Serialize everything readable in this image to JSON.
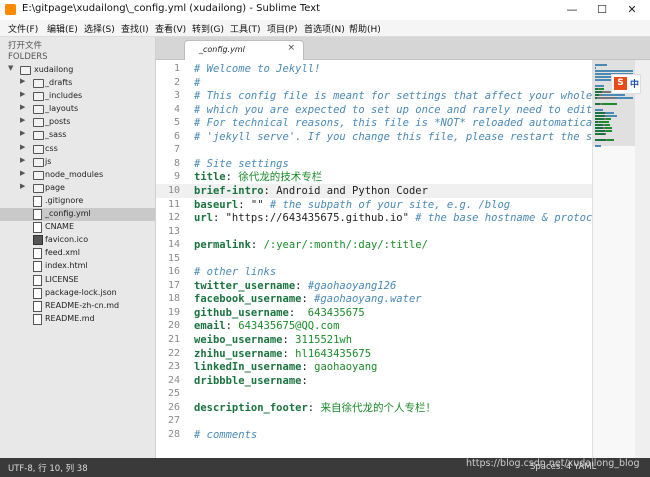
{
  "window": {
    "title": "E:\\gitpage\\xudailong\\_config.yml (xudailong) - Sublime Text",
    "minimize": "—",
    "maximize": "☐",
    "close": "✕"
  },
  "menu": [
    "文件(F)",
    "编辑(E)",
    "选择(S)",
    "查找(I)",
    "查看(V)",
    "转到(G)",
    "工具(T)",
    "项目(P)",
    "首选项(N)",
    "帮助(H)"
  ],
  "sidebar": {
    "open_files": "打开文件",
    "folders_label": "FOLDERS",
    "root": "xudailong",
    "items": [
      {
        "type": "folder",
        "label": "_drafts"
      },
      {
        "type": "folder",
        "label": "_includes"
      },
      {
        "type": "folder",
        "label": "_layouts"
      },
      {
        "type": "folder",
        "label": "_posts"
      },
      {
        "type": "folder",
        "label": "_sass"
      },
      {
        "type": "folder",
        "label": "css"
      },
      {
        "type": "folder",
        "label": "js"
      },
      {
        "type": "folder",
        "label": "node_modules"
      },
      {
        "type": "folder",
        "label": "page"
      },
      {
        "type": "file",
        "label": ".gitignore"
      },
      {
        "type": "file",
        "label": "_config.yml",
        "selected": true
      },
      {
        "type": "file",
        "label": "CNAME"
      },
      {
        "type": "image",
        "label": "favicon.ico"
      },
      {
        "type": "file",
        "label": "feed.xml"
      },
      {
        "type": "file",
        "label": "index.html"
      },
      {
        "type": "file",
        "label": "LICENSE"
      },
      {
        "type": "file",
        "label": "package-lock.json"
      },
      {
        "type": "file",
        "label": "README-zh-cn.md"
      },
      {
        "type": "file",
        "label": "README.md"
      }
    ]
  },
  "tab": {
    "label": "_config.yml",
    "close": "×"
  },
  "editor": {
    "current_line": 10,
    "lines": [
      {
        "n": "1",
        "parts": [
          {
            "t": "# Welcome to Jekyll!",
            "c": "comment"
          }
        ]
      },
      {
        "n": "2",
        "parts": [
          {
            "t": "#",
            "c": "comment"
          }
        ]
      },
      {
        "n": "3",
        "parts": [
          {
            "t": "# This config file is meant for settings that affect your whole",
            "c": "comment"
          }
        ]
      },
      {
        "n": "4",
        "parts": [
          {
            "t": "# which you are expected to set up once and rarely need to edit",
            "c": "comment"
          }
        ]
      },
      {
        "n": "5",
        "parts": [
          {
            "t": "# For technical reasons, this file is *NOT* reloaded automatica",
            "c": "comment"
          }
        ]
      },
      {
        "n": "6",
        "parts": [
          {
            "t": "# 'jekyll serve'. If you change this file, please restart the se",
            "c": "comment"
          }
        ]
      },
      {
        "n": "7",
        "parts": []
      },
      {
        "n": "8",
        "parts": [
          {
            "t": "# Site settings",
            "c": "comment"
          }
        ]
      },
      {
        "n": "9",
        "parts": [
          {
            "t": "title",
            "c": "key"
          },
          {
            "t": ": ",
            "c": "val"
          },
          {
            "t": "徐代龙的技术专栏",
            "c": "str"
          }
        ]
      },
      {
        "n": "10",
        "parts": [
          {
            "t": "brief-intro",
            "c": "key"
          },
          {
            "t": ": Android and Python Coder",
            "c": "val"
          }
        ]
      },
      {
        "n": "11",
        "parts": [
          {
            "t": "baseurl",
            "c": "key"
          },
          {
            "t": ": \"\" ",
            "c": "val"
          },
          {
            "t": "# the subpath of your site, e.g. /blog",
            "c": "comment"
          }
        ]
      },
      {
        "n": "12",
        "parts": [
          {
            "t": "url",
            "c": "key"
          },
          {
            "t": ": \"https://643435675.github.io\" ",
            "c": "val"
          },
          {
            "t": "# the base hostname & protoco",
            "c": "comment"
          }
        ]
      },
      {
        "n": "13",
        "parts": []
      },
      {
        "n": "14",
        "parts": [
          {
            "t": "permalink",
            "c": "key"
          },
          {
            "t": ": ",
            "c": "val"
          },
          {
            "t": "/:year/:month/:day/:title/",
            "c": "str"
          }
        ]
      },
      {
        "n": "15",
        "parts": []
      },
      {
        "n": "16",
        "parts": [
          {
            "t": "# other links",
            "c": "comment"
          }
        ]
      },
      {
        "n": "17",
        "parts": [
          {
            "t": "twitter_username",
            "c": "key"
          },
          {
            "t": ": ",
            "c": "val"
          },
          {
            "t": "#gaohaoyang126",
            "c": "comment"
          }
        ]
      },
      {
        "n": "18",
        "parts": [
          {
            "t": "facebook_username",
            "c": "key"
          },
          {
            "t": ": ",
            "c": "val"
          },
          {
            "t": "#gaohaoyang.water",
            "c": "comment"
          }
        ]
      },
      {
        "n": "19",
        "parts": [
          {
            "t": "github_username",
            "c": "key"
          },
          {
            "t": ":  ",
            "c": "val"
          },
          {
            "t": "643435675",
            "c": "str"
          }
        ]
      },
      {
        "n": "20",
        "parts": [
          {
            "t": "email",
            "c": "key"
          },
          {
            "t": ": ",
            "c": "val"
          },
          {
            "t": "643435675@QQ.com",
            "c": "str"
          }
        ]
      },
      {
        "n": "21",
        "parts": [
          {
            "t": "weibo_username",
            "c": "key"
          },
          {
            "t": ": ",
            "c": "val"
          },
          {
            "t": "3115521wh",
            "c": "str"
          }
        ]
      },
      {
        "n": "22",
        "parts": [
          {
            "t": "zhihu_username",
            "c": "key"
          },
          {
            "t": ": ",
            "c": "val"
          },
          {
            "t": "hl1643435675",
            "c": "str"
          }
        ]
      },
      {
        "n": "23",
        "parts": [
          {
            "t": "linkedIn_username",
            "c": "key"
          },
          {
            "t": ": ",
            "c": "val"
          },
          {
            "t": "gaohaoyang",
            "c": "str"
          }
        ]
      },
      {
        "n": "24",
        "parts": [
          {
            "t": "dribbble_username",
            "c": "key"
          },
          {
            "t": ":",
            "c": "val"
          }
        ]
      },
      {
        "n": "25",
        "parts": []
      },
      {
        "n": "26",
        "parts": [
          {
            "t": "description_footer",
            "c": "key"
          },
          {
            "t": ": ",
            "c": "val"
          },
          {
            "t": "来自徐代龙的个人专栏！",
            "c": "str"
          }
        ]
      },
      {
        "n": "27",
        "parts": []
      },
      {
        "n": "28",
        "parts": [
          {
            "t": "# comments",
            "c": "comment"
          }
        ]
      }
    ]
  },
  "status": {
    "left": "UTF-8, 行 10, 列 38",
    "right": "Spaces: 4    YAML"
  },
  "watermark": "https://blog.csdn.net/xudailong_blog",
  "ime": {
    "logo": "S",
    "text": "中"
  },
  "colors": {
    "comment": "#4a8ab5",
    "key": "#1b7340",
    "string": "#1c8b2a",
    "status_bar": "#3a3a3a"
  }
}
